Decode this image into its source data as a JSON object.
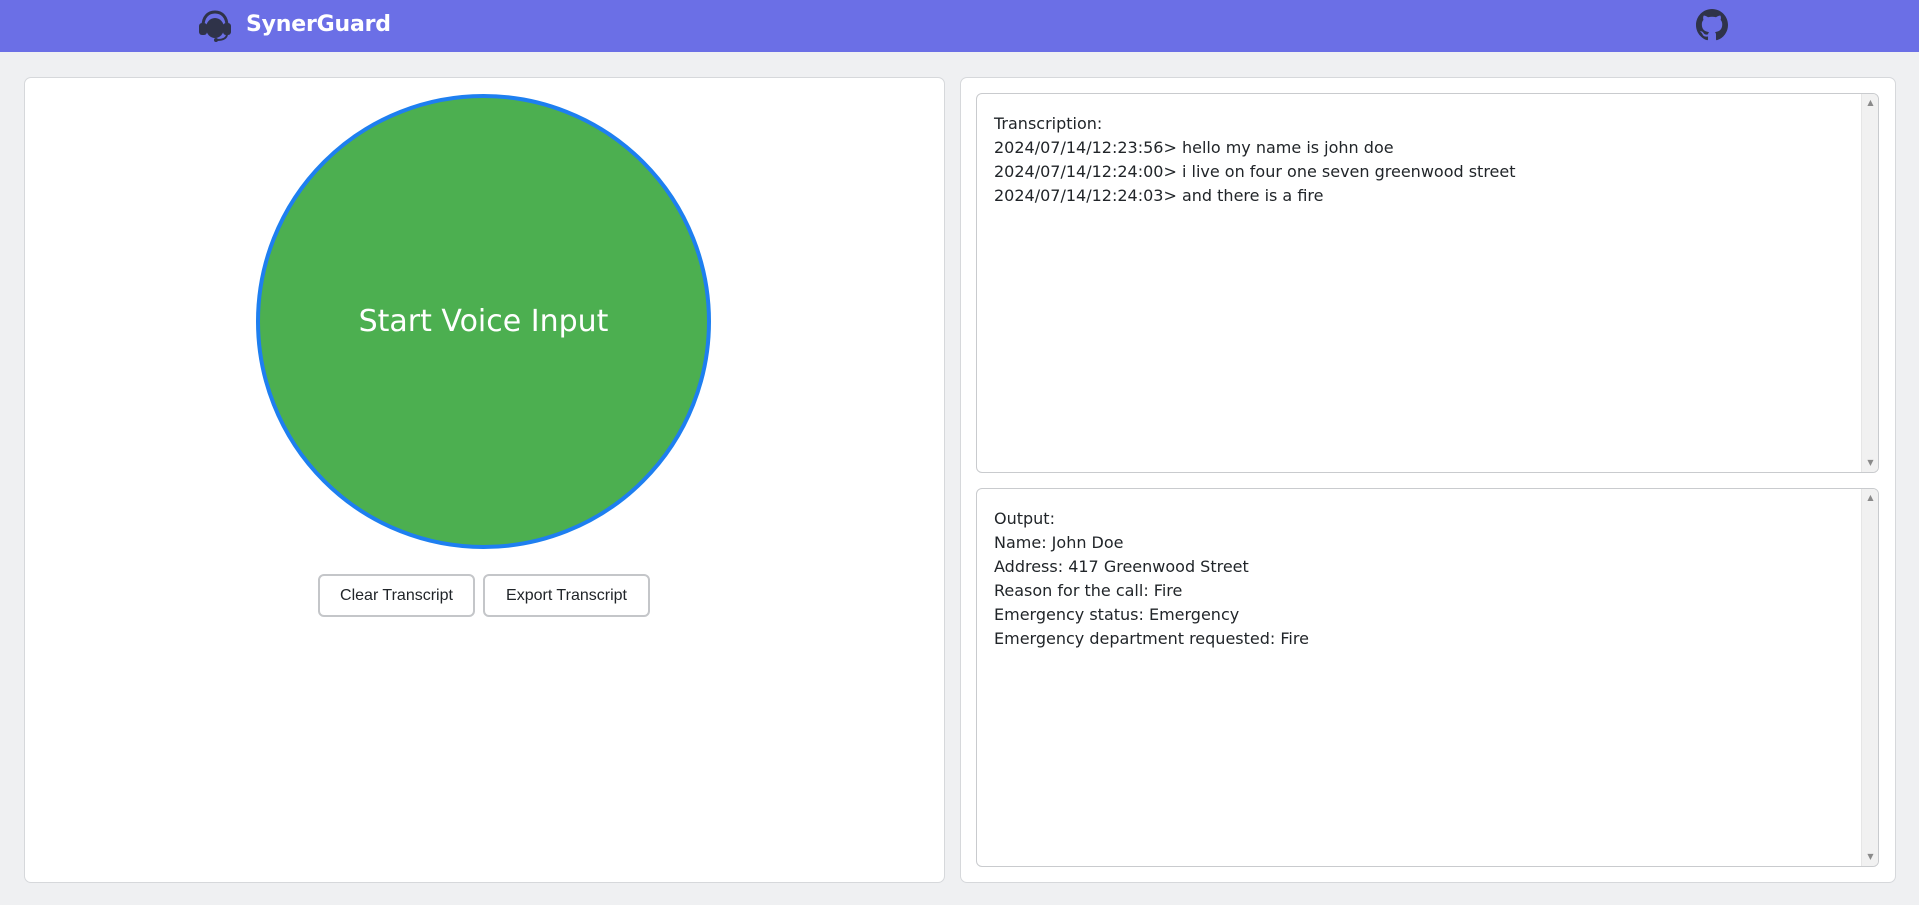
{
  "header": {
    "brand_name": "SynerGuard",
    "brand_icon": "headset-icon",
    "github_icon": "github-icon",
    "background_color": "#6b6fe6"
  },
  "voice": {
    "button_label": "Start Voice Input",
    "button_color": "#4caf50",
    "border_color": "#1e7ff0"
  },
  "actions": {
    "clear_label": "Clear Transcript",
    "export_label": "Export Transcript"
  },
  "transcription": {
    "heading": "Transcription:",
    "lines": [
      "2024/07/14/12:23:56> hello my name is john doe",
      "2024/07/14/12:24:00> i live on four one seven greenwood street",
      "2024/07/14/12:24:03> and there is a fire"
    ]
  },
  "output": {
    "heading": "Output:",
    "lines": [
      "Name: John Doe",
      "Address: 417 Greenwood Street",
      "Reason for the call: Fire",
      "Emergency status: Emergency",
      "Emergency department requested: Fire"
    ]
  }
}
